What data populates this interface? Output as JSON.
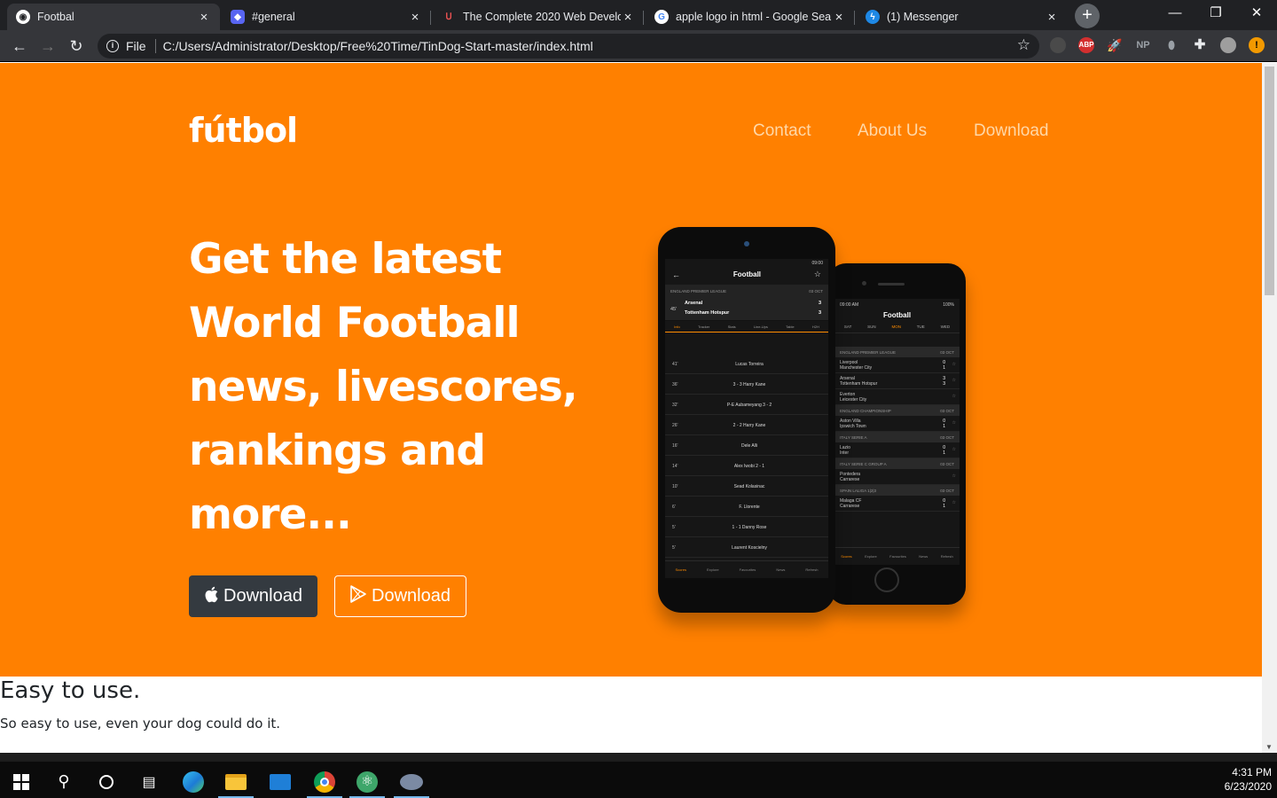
{
  "browser": {
    "tabs": [
      {
        "title": "Footbal",
        "active": true
      },
      {
        "title": "#general",
        "active": false
      },
      {
        "title": "The Complete 2020 Web Develop",
        "active": false
      },
      {
        "title": "apple logo in html - Google Sear",
        "active": false
      },
      {
        "title": "(1) Messenger",
        "active": false
      }
    ],
    "address_scheme": "File",
    "address": "C:/Users/Administrator/Desktop/Free%20Time/TinDog-Start-master/index.html",
    "extensions": [
      "ABP",
      "NP"
    ]
  },
  "site": {
    "brand": "fútbol",
    "nav": [
      "Contact",
      "About Us",
      "Download"
    ],
    "headline_lines": [
      "Get the latest",
      "World Football",
      "news, livescores,",
      "rankings and",
      "more..."
    ],
    "buttons": {
      "apple": "Download",
      "play": "Download"
    },
    "colors": {
      "hero": "#ff8000",
      "dark_button": "#343a40"
    }
  },
  "phone_front": {
    "status_time": "09:00",
    "title": "Football",
    "league": "ENGLAND PREMIER LEAGUE",
    "date": "03 OCT",
    "minute": "45'",
    "home": "Arsenal",
    "away": "Tottenham Hotspur",
    "home_score": "3",
    "away_score": "3",
    "tabs": [
      "Info",
      "Tracker",
      "Stats",
      "Line-Ups",
      "Table",
      "H2H"
    ],
    "events": [
      {
        "min": "41'",
        "text": "Lucas Torreira"
      },
      {
        "min": "36'",
        "text": "3 - 3  Harry Kane"
      },
      {
        "min": "32'",
        "text": "P-E Aubameyang  3 - 2"
      },
      {
        "min": "26'",
        "text": "2 - 2  Harry Kane"
      },
      {
        "min": "16'",
        "text": "Dele Alli"
      },
      {
        "min": "14'",
        "text": "Alex Iwobi  2 - 1"
      },
      {
        "min": "10'",
        "text": "Sead Kolasinac"
      },
      {
        "min": "6'",
        "text": "F. Llorente"
      },
      {
        "min": "5'",
        "text": "1 - 1  Danny Rose"
      },
      {
        "min": "5'",
        "text": "Laurent Koscielny"
      }
    ],
    "bottom_tabs": [
      "Scores",
      "Explore",
      "Favourites",
      "News",
      "Refresh"
    ]
  },
  "phone_back": {
    "status_time": "09:00 AM",
    "battery": "100%",
    "title": "Football",
    "days": [
      "SAT",
      "SUN",
      "MON",
      "TUE",
      "WED"
    ],
    "rows": [
      {
        "type": "head",
        "text": "ENGLAND PREMIER LEAGUE",
        "date": "03 OCT"
      },
      {
        "type": "match",
        "a": "Liverpool",
        "b": "Manchester City",
        "sa": "0",
        "sb": "1"
      },
      {
        "type": "match",
        "a": "Arsenal",
        "b": "Tottenham Hotspur",
        "sa": "3",
        "sb": "3"
      },
      {
        "type": "match",
        "a": "Everton",
        "b": "Leicester City",
        "sa": "",
        "sb": ""
      },
      {
        "type": "head",
        "text": "ENGLAND CHAMPIONSHIP",
        "date": "03 OCT"
      },
      {
        "type": "match",
        "a": "Aston Villa",
        "b": "Ipswich Town",
        "sa": "0",
        "sb": "1"
      },
      {
        "type": "head",
        "text": "ITALY SERIE A",
        "date": "03 OCT"
      },
      {
        "type": "match",
        "a": "Lazio",
        "b": "Inter",
        "sa": "0",
        "sb": "1"
      },
      {
        "type": "head",
        "text": "ITALY SERIE C GROUP A",
        "date": "03 OCT"
      },
      {
        "type": "match",
        "a": "Pontedera",
        "b": "Carrarese",
        "sa": "",
        "sb": ""
      },
      {
        "type": "head",
        "text": "SPAIN LALIGA 1|2|3",
        "date": "03 OCT"
      },
      {
        "type": "match",
        "a": "Malaga CF",
        "b": "Carrarese",
        "sa": "0",
        "sb": "1"
      }
    ],
    "bottom_tabs": [
      "Scores",
      "Explore",
      "Favourites",
      "News",
      "Refresh"
    ]
  },
  "section2": {
    "heading": "Easy to use.",
    "text": "So easy to use, even your dog could do it."
  },
  "taskbar": {
    "time": "4:31 PM",
    "date": "6/23/2020"
  }
}
